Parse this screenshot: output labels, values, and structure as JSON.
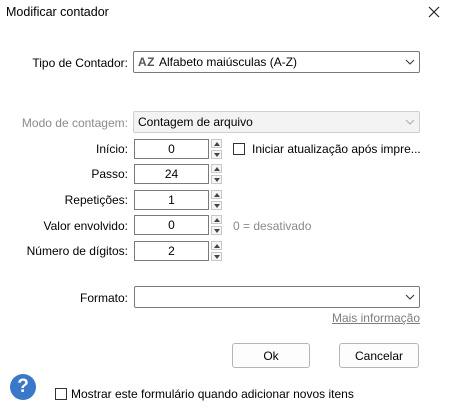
{
  "window": {
    "title": "Modificar contador"
  },
  "counter_type": {
    "label": "Tipo de Contador:",
    "icon_text": "AZ",
    "value": "Alfabeto maiúsculas (A-Z)"
  },
  "count_mode": {
    "label": "Modo de contagem:",
    "value": "Contagem de arquivo"
  },
  "fields": {
    "start": {
      "label": "Início:",
      "value": "0"
    },
    "step": {
      "label": "Passo:",
      "value": "24"
    },
    "repeats": {
      "label": "Repetições:",
      "value": "1"
    },
    "wrap": {
      "label": "Valor envolvido:",
      "value": "0",
      "hint": "0 = desativado"
    },
    "digits": {
      "label": "Número de dígitos:",
      "value": "2"
    }
  },
  "restart_checkbox": {
    "label": "Iniciar atualização após impre...",
    "checked": false
  },
  "format": {
    "label": "Formato:",
    "value": "",
    "more_info": "Mais informação"
  },
  "buttons": {
    "ok": "Ok",
    "cancel": "Cancelar"
  },
  "show_form_checkbox": {
    "label": "Mostrar este formulário quando adicionar novos itens",
    "checked": false
  },
  "help": {
    "glyph": "?"
  },
  "colors": {
    "accent": "#3a78c9",
    "disabled_text": "#8a8a8a"
  }
}
